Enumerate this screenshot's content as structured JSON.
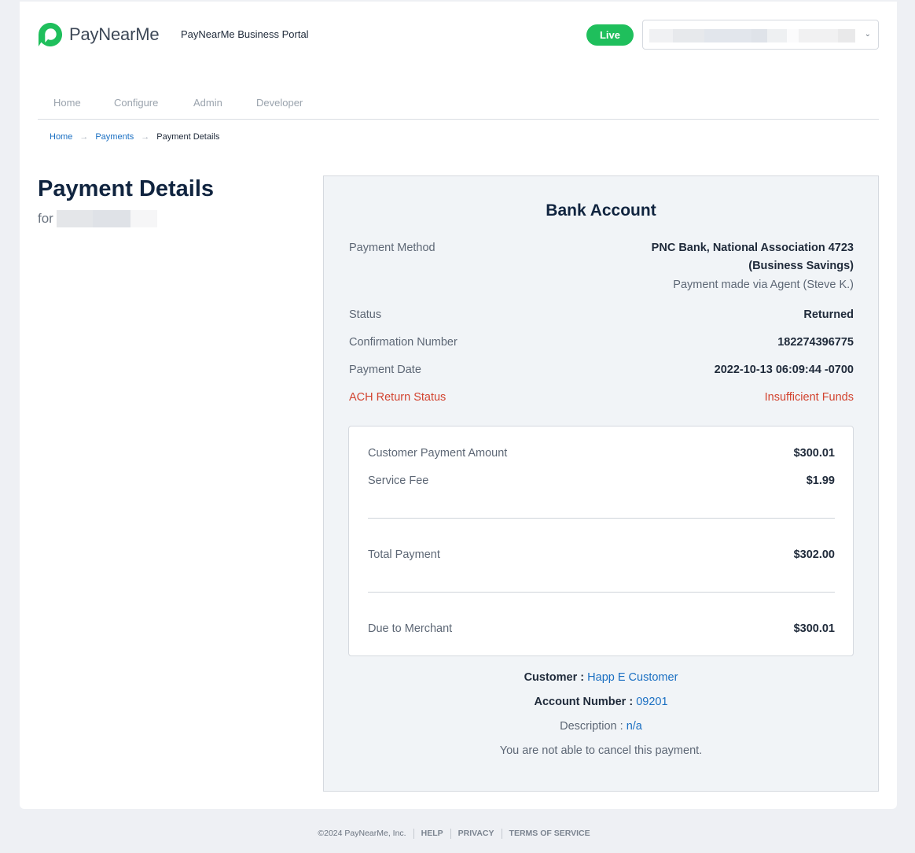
{
  "app": {
    "brand": "PayNearMe",
    "portal_title": "PayNearMe Business Portal",
    "live_badge": "Live",
    "brand_color": "#1fbf5c"
  },
  "nav": {
    "items": [
      {
        "label": "Home"
      },
      {
        "label": "Configure"
      },
      {
        "label": "Admin"
      },
      {
        "label": "Developer"
      }
    ]
  },
  "breadcrumb": {
    "items": [
      "Home",
      "Payments",
      "Payment Details"
    ],
    "separator": "→"
  },
  "page": {
    "title": "Payment Details",
    "for_label": "for"
  },
  "details": {
    "heading": "Bank Account",
    "payment_method_label": "Payment Method",
    "payment_method_line1": "PNC Bank, National Association 4723",
    "payment_method_line2": "(Business Savings)",
    "payment_method_note": "Payment made via Agent (Steve K.)",
    "status_label": "Status",
    "status_value": "Returned",
    "confirmation_label": "Confirmation Number",
    "confirmation_value": "182274396775",
    "date_label": "Payment Date",
    "date_value": "2022-10-13 06:09:44 -0700",
    "ach_label": "ACH Return Status",
    "ach_value": "Insufficient Funds",
    "alert_color": "#d2432f"
  },
  "amounts": {
    "customer_amount_label": "Customer Payment Amount",
    "customer_amount_value": "$300.01",
    "service_fee_label": "Service Fee",
    "service_fee_value": "$1.99",
    "total_label": "Total Payment",
    "total_value": "$302.00",
    "due_label": "Due to Merchant",
    "due_value": "$300.01"
  },
  "customer": {
    "customer_label": "Customer :",
    "customer_name": "Happ E Customer",
    "account_label": "Account Number :",
    "account_number": "09201",
    "description_label": "Description :",
    "description_value": "n/a",
    "cancel_note": "You are not able to cancel this payment."
  },
  "footer": {
    "copyright": "©2024 PayNearMe, Inc.",
    "links": [
      "HELP",
      "PRIVACY",
      "TERMS OF SERVICE"
    ]
  }
}
